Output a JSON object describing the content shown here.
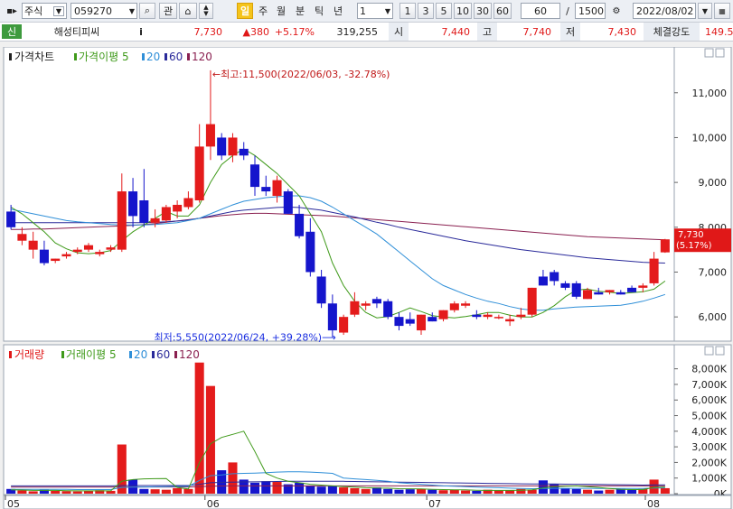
{
  "toolbar": {
    "market": "주식",
    "code": "059270",
    "btn_search": "⌕",
    "btn_gwan": "관",
    "btn_scroll": "⌂",
    "periods": [
      "일",
      "주",
      "월",
      "분",
      "틱",
      "년"
    ],
    "active_period": "일",
    "unit_value": "1",
    "quick_units": [
      "1",
      "3",
      "5",
      "10",
      "30",
      "60"
    ],
    "count": "60",
    "slash": "/",
    "total": "1500",
    "date": "2022/08/02"
  },
  "info": {
    "badge": "신",
    "name": "해성티피씨",
    "i_btn": "i",
    "price": "7,730",
    "change": "▲380",
    "change_pct": "+5.17%",
    "volume": "319,255",
    "open_label": "시",
    "open": "7,440",
    "high_label": "고",
    "high": "7,740",
    "low_label": "저",
    "low": "7,430",
    "strength_label": "체결강도",
    "strength": "149.5"
  },
  "colors": {
    "up": "#e41b1b",
    "down": "#1515cc",
    "ma5": "#3f9a1a",
    "ma20": "#2f8fd8",
    "ma60": "#2a2a9a",
    "ma120": "#8a2050",
    "annot": "#c01818",
    "annot_low": "#1a2ee0"
  },
  "chart_data": [
    {
      "type": "candlestick",
      "legend": {
        "title": "가격차트",
        "ma_label": "가격이평",
        "periods": [
          "5",
          "20",
          "60",
          "120"
        ]
      },
      "y_ticks": [
        "11,000",
        "10,000",
        "9,000",
        "8,000",
        "7,000",
        "6,000"
      ],
      "y_tick_values": [
        11000,
        10000,
        9000,
        8000,
        7000,
        6000
      ],
      "ylim": [
        5500,
        11700
      ],
      "x_ticks": [
        "05",
        "06",
        "07",
        "08"
      ],
      "x_tick_index": [
        0,
        18,
        38,
        60
      ],
      "last_price_label": [
        "7,730",
        "(5.17%)"
      ],
      "annotation_high": "←최고:11,500(2022/06/03, -32.78%)",
      "annotation_low": "최저:5,550(2022/06/24, +39.28%)⟶",
      "ohlc": [
        [
          8350,
          8500,
          7950,
          8000
        ],
        [
          7700,
          8000,
          7600,
          7850
        ],
        [
          7500,
          7900,
          7300,
          7700
        ],
        [
          7500,
          7700,
          7150,
          7200
        ],
        [
          7250,
          7300,
          7200,
          7300
        ],
        [
          7350,
          7450,
          7300,
          7400
        ],
        [
          7450,
          7550,
          7400,
          7500
        ],
        [
          7500,
          7650,
          7450,
          7600
        ],
        [
          7400,
          7500,
          7350,
          7450
        ],
        [
          7500,
          7600,
          7450,
          7550
        ],
        [
          7500,
          9200,
          7450,
          8800
        ],
        [
          8800,
          9100,
          8000,
          8250
        ],
        [
          8600,
          9300,
          8000,
          8100
        ],
        [
          8100,
          8400,
          8000,
          8200
        ],
        [
          8150,
          8500,
          8100,
          8450
        ],
        [
          8350,
          8600,
          8200,
          8500
        ],
        [
          8450,
          8800,
          8400,
          8650
        ],
        [
          8600,
          10300,
          8550,
          9800
        ],
        [
          9800,
          11500,
          9500,
          10300
        ],
        [
          10000,
          10100,
          9500,
          9600
        ],
        [
          9600,
          10100,
          9450,
          10000
        ],
        [
          9750,
          9900,
          9500,
          9600
        ],
        [
          9400,
          9600,
          8700,
          8900
        ],
        [
          8900,
          9150,
          8700,
          8800
        ],
        [
          8700,
          9150,
          8550,
          9050
        ],
        [
          8800,
          8850,
          8300,
          8300
        ],
        [
          8300,
          8500,
          7750,
          7800
        ],
        [
          7900,
          8200,
          6900,
          7000
        ],
        [
          6900,
          7050,
          6200,
          6300
        ],
        [
          6300,
          6500,
          5550,
          5700
        ],
        [
          5650,
          6050,
          5600,
          6000
        ],
        [
          6050,
          6550,
          6000,
          6350
        ],
        [
          6250,
          6350,
          6150,
          6300
        ],
        [
          6400,
          6450,
          6200,
          6300
        ],
        [
          6350,
          6400,
          5950,
          6000
        ],
        [
          6000,
          6100,
          5700,
          5800
        ],
        [
          5950,
          6100,
          5800,
          5850
        ],
        [
          5700,
          6050,
          5600,
          6050
        ],
        [
          6000,
          6100,
          5900,
          5900
        ],
        [
          5950,
          6150,
          5900,
          6150
        ],
        [
          6150,
          6350,
          6100,
          6300
        ],
        [
          6250,
          6350,
          6200,
          6300
        ],
        [
          6050,
          6150,
          5950,
          6000
        ],
        [
          6000,
          6100,
          5950,
          6050
        ],
        [
          6000,
          6050,
          5950,
          6000
        ],
        [
          5900,
          6050,
          5800,
          5950
        ],
        [
          6000,
          6200,
          5950,
          6050
        ],
        [
          6050,
          6650,
          6000,
          6650
        ],
        [
          6900,
          7050,
          6700,
          6700
        ],
        [
          7000,
          7050,
          6700,
          6800
        ],
        [
          6750,
          6800,
          6600,
          6650
        ],
        [
          6750,
          6800,
          6400,
          6450
        ],
        [
          6400,
          6650,
          6400,
          6600
        ],
        [
          6550,
          6650,
          6500,
          6500
        ],
        [
          6550,
          6600,
          6500,
          6600
        ],
        [
          6550,
          6600,
          6500,
          6500
        ],
        [
          6650,
          6700,
          6550,
          6550
        ],
        [
          6650,
          6750,
          6550,
          6700
        ],
        [
          6750,
          7450,
          6700,
          7300
        ],
        [
          7440,
          7740,
          7430,
          7730
        ]
      ],
      "ma5": [
        8450,
        8300,
        8100,
        7900,
        7650,
        7520,
        7430,
        7410,
        7430,
        7480,
        7700,
        7900,
        8050,
        8200,
        8350,
        8250,
        8250,
        8500,
        9000,
        9400,
        9600,
        9750,
        9600,
        9400,
        9200,
        8950,
        8700,
        8300,
        7900,
        7200,
        6700,
        6350,
        6100,
        5980,
        6010,
        6100,
        6200,
        6120,
        6030,
        6000,
        5980,
        6010,
        6050,
        6100,
        6100,
        6040,
        6000,
        6000,
        6100,
        6250,
        6450,
        6600,
        6620,
        6570,
        6550,
        6520,
        6540,
        6560,
        6620,
        6800
      ],
      "ma20": [
        8400,
        8350,
        8300,
        8250,
        8200,
        8150,
        8120,
        8100,
        8080,
        8060,
        8050,
        8050,
        8050,
        8060,
        8080,
        8100,
        8150,
        8200,
        8300,
        8400,
        8500,
        8580,
        8620,
        8660,
        8680,
        8700,
        8700,
        8660,
        8580,
        8450,
        8300,
        8150,
        8000,
        7850,
        7650,
        7450,
        7250,
        7050,
        6850,
        6700,
        6600,
        6500,
        6420,
        6350,
        6300,
        6230,
        6180,
        6150,
        6150,
        6180,
        6200,
        6220,
        6230,
        6240,
        6250,
        6260,
        6300,
        6350,
        6420,
        6500
      ],
      "ma60": [
        8100,
        8100,
        8100,
        8100,
        8100,
        8100,
        8100,
        8100,
        8100,
        8100,
        8100,
        8100,
        8100,
        8110,
        8120,
        8140,
        8160,
        8200,
        8250,
        8300,
        8350,
        8380,
        8400,
        8420,
        8440,
        8450,
        8440,
        8410,
        8380,
        8330,
        8280,
        8230,
        8170,
        8110,
        8060,
        8000,
        7950,
        7900,
        7850,
        7800,
        7750,
        7700,
        7660,
        7620,
        7580,
        7540,
        7500,
        7470,
        7440,
        7410,
        7380,
        7350,
        7320,
        7300,
        7280,
        7260,
        7240,
        7220,
        7210,
        7200
      ],
      "ma120": [
        7950,
        7950,
        7960,
        7960,
        7970,
        7980,
        7990,
        8000,
        8010,
        8020,
        8030,
        8040,
        8060,
        8080,
        8110,
        8140,
        8170,
        8200,
        8230,
        8260,
        8280,
        8300,
        8310,
        8310,
        8300,
        8290,
        8280,
        8270,
        8260,
        8250,
        8230,
        8210,
        8190,
        8170,
        8150,
        8130,
        8110,
        8090,
        8070,
        8050,
        8030,
        8010,
        7990,
        7970,
        7950,
        7930,
        7910,
        7890,
        7870,
        7850,
        7830,
        7810,
        7790,
        7780,
        7770,
        7760,
        7750,
        7740,
        7730,
        7720
      ]
    },
    {
      "type": "bar",
      "legend": {
        "title": "거래량",
        "ma_label": "거래이평",
        "periods": [
          "5",
          "20",
          "60",
          "120"
        ]
      },
      "y_ticks": [
        "8,000K",
        "7,000K",
        "6,000K",
        "5,000K",
        "4,000K",
        "3,000K",
        "2,000K",
        "1,000K",
        "0K"
      ],
      "y_tick_values": [
        8000,
        7000,
        6000,
        5000,
        4000,
        3000,
        2000,
        1000,
        0
      ],
      "ylim": [
        0,
        8500
      ],
      "unit": "K",
      "values": [
        300,
        200,
        150,
        250,
        180,
        160,
        140,
        200,
        220,
        180,
        3150,
        900,
        300,
        280,
        250,
        350,
        300,
        8400,
        6900,
        1500,
        2000,
        900,
        700,
        800,
        750,
        600,
        700,
        500,
        450,
        500,
        400,
        350,
        300,
        400,
        300,
        250,
        280,
        300,
        250,
        220,
        250,
        200,
        180,
        250,
        200,
        220,
        300,
        250,
        850,
        600,
        350,
        300,
        250,
        200,
        250,
        300,
        250,
        300,
        900,
        350
      ],
      "ma5": [
        250,
        230,
        210,
        210,
        210,
        190,
        180,
        180,
        180,
        180,
        800,
        900,
        950,
        960,
        970,
        400,
        300,
        2000,
        3200,
        3600,
        3800,
        4000,
        2700,
        1300,
        1000,
        800,
        700,
        600,
        550,
        500,
        450,
        420,
        380,
        360,
        350,
        320,
        310,
        300,
        280,
        260,
        250,
        240,
        220,
        210,
        210,
        210,
        220,
        240,
        370,
        440,
        480,
        500,
        450,
        400,
        330,
        270,
        260,
        260,
        400,
        420
      ],
      "ma20": [
        280,
        280,
        280,
        270,
        270,
        270,
        260,
        260,
        260,
        260,
        400,
        420,
        430,
        440,
        450,
        460,
        470,
        850,
        1150,
        1200,
        1280,
        1300,
        1320,
        1350,
        1380,
        1400,
        1400,
        1380,
        1350,
        1300,
        1000,
        950,
        900,
        850,
        800,
        700,
        650,
        600,
        550,
        500,
        480,
        450,
        420,
        400,
        380,
        350,
        330,
        320,
        330,
        340,
        340,
        340,
        340,
        330,
        330,
        330,
        330,
        330,
        360,
        370
      ],
      "ma60": [
        500,
        500,
        500,
        500,
        500,
        500,
        500,
        500,
        500,
        500,
        520,
        520,
        520,
        520,
        520,
        520,
        520,
        600,
        700,
        720,
        740,
        750,
        760,
        770,
        780,
        790,
        800,
        800,
        800,
        800,
        790,
        780,
        770,
        760,
        750,
        740,
        730,
        720,
        710,
        700,
        690,
        680,
        670,
        660,
        650,
        640,
        630,
        620,
        620,
        620,
        610,
        600,
        600,
        590,
        580,
        570,
        560,
        550,
        560,
        560
      ],
      "ma120": [
        420,
        420,
        420,
        420,
        420,
        420,
        420,
        420,
        420,
        420,
        430,
        430,
        430,
        430,
        430,
        430,
        430,
        450,
        480,
        490,
        500,
        500,
        500,
        500,
        500,
        500,
        500,
        500,
        500,
        500,
        500,
        500,
        500,
        500,
        500,
        500,
        500,
        500,
        500,
        500,
        500,
        500,
        500,
        500,
        500,
        500,
        500,
        500,
        500,
        500,
        500,
        500,
        500,
        500,
        500,
        500,
        500,
        500,
        500,
        500
      ]
    }
  ]
}
